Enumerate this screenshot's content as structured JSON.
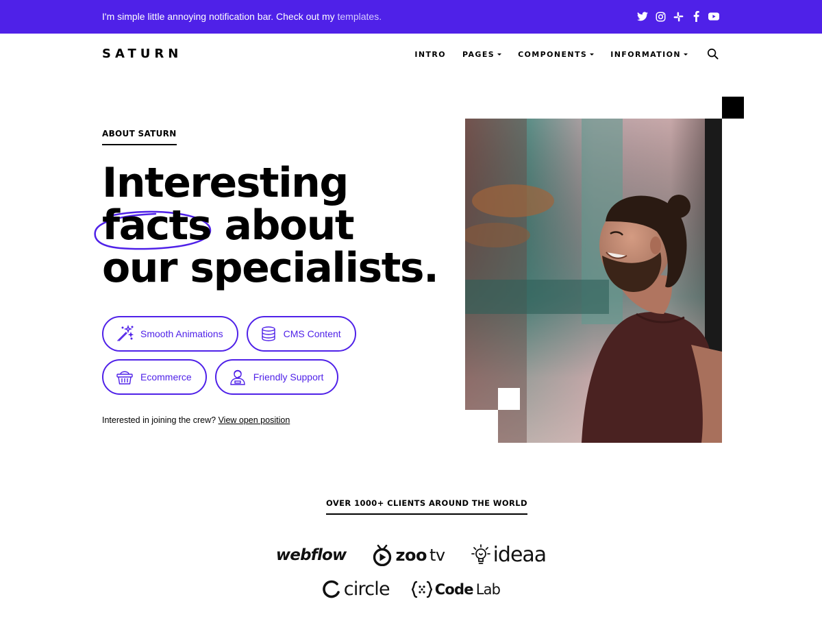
{
  "notification": {
    "text": "I'm simple little annoying notification bar. Check out my",
    "link": "templates.",
    "social_icons": [
      "twitter-icon",
      "instagram-icon",
      "slack-icon",
      "facebook-icon",
      "youtube-icon"
    ]
  },
  "header": {
    "logo": "SATURN",
    "nav": [
      {
        "label": "INTRO",
        "dropdown": false
      },
      {
        "label": "PAGES",
        "dropdown": true
      },
      {
        "label": "COMPONENTS",
        "dropdown": true
      },
      {
        "label": "INFORMATION",
        "dropdown": true
      }
    ],
    "search_icon": "search-icon"
  },
  "hero": {
    "eyebrow": "ABOUT SATURN",
    "headline": {
      "line1": "Interesting",
      "highlight": "facts",
      "line2_rest": "about",
      "line3": "our specialists."
    },
    "features": [
      {
        "label": "Smooth Animations",
        "icon": "magic-wand-icon"
      },
      {
        "label": "CMS Content",
        "icon": "database-icon"
      },
      {
        "label": "Ecommerce",
        "icon": "basket-icon"
      },
      {
        "label": "Friendly Support",
        "icon": "support-agent-icon"
      }
    ],
    "join_text": "Interested in joining the crew?",
    "join_link": "View open position"
  },
  "clients": {
    "title": "OVER 1000+ CLIENTS AROUND THE WORLD",
    "logos": {
      "webflow": "webflow",
      "zootv_a": "zoo",
      "zootv_b": "tv",
      "ideaa": "ideaa",
      "circle": "circle",
      "codelab_a": "Code",
      "codelab_b": "Lab"
    }
  },
  "colors": {
    "accent": "#4f21e8",
    "text": "#000000",
    "background": "#ffffff"
  }
}
